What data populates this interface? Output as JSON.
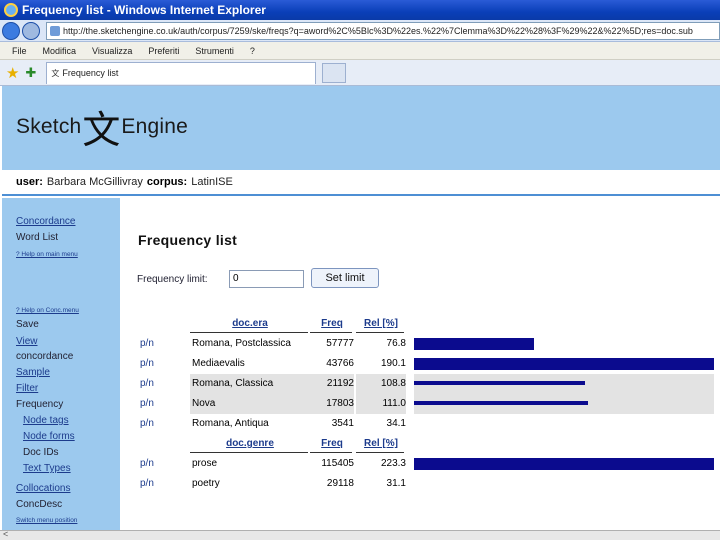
{
  "window": {
    "title": "Frequency list - Windows Internet Explorer",
    "url": "http://the.sketchengine.co.uk/auth/corpus/7259/ske/freqs?q=aword%2C%5Blc%3D%22es.%22%7Clemma%3D%22%28%3F%29%22&%22%5D;res=doc.sub",
    "menu": [
      "File",
      "Modifica",
      "Visualizza",
      "Preferiti",
      "Strumenti",
      "?"
    ],
    "tab_title": "Frequency list"
  },
  "header": {
    "logo_left": "Sketch",
    "logo_glyph": "文",
    "logo_right": "Engine",
    "user_label": "user:",
    "user_name": "Barbara McGillivray",
    "corpus_label": "corpus:",
    "corpus_name": "LatinISE"
  },
  "sidebar": {
    "concordance": "Concordance",
    "word_list": "Word List",
    "help_main": "? Help on main menu",
    "help_conc": "? Help on Conc.menu",
    "save": "Save",
    "view": "View",
    "concordance_plain": "concordance",
    "sample": "Sample",
    "filter": "Filter",
    "frequency": "Frequency",
    "node_tags": "Node tags",
    "node_forms": "Node forms",
    "doc_ids": "Doc IDs",
    "text_types": "Text Types",
    "collocations": "Collocations",
    "concdesc": "ConcDesc",
    "switch_menu": "Switch menu position"
  },
  "main": {
    "title": "Frequency list",
    "frequency_limit_label": "Frequency limit:",
    "frequency_limit_value": "0",
    "set_limit_button": "Set limit",
    "pn": "p/n",
    "tables": [
      {
        "headers": [
          "doc.era",
          "Freq",
          "Rel [%]"
        ],
        "rows": [
          {
            "label": "Romana, Postclassica",
            "freq": "57777",
            "rel": "76.8",
            "bar": 0.4,
            "shade": false
          },
          {
            "label": "Mediaevalis",
            "freq": "43766",
            "rel": "190.1",
            "bar": 1.0,
            "shade": false
          },
          {
            "label": "Romana, Classica",
            "freq": "21192",
            "rel": "108.8",
            "bar": 0.57,
            "shade": true
          },
          {
            "label": "Nova",
            "freq": "17803",
            "rel": "111.0",
            "bar": 0.58,
            "shade": true
          },
          {
            "label": "Romana, Antiqua",
            "freq": "3541",
            "rel": "34.1",
            "bar": 0.0,
            "shade": false
          }
        ]
      },
      {
        "headers": [
          "doc.genre",
          "Freq",
          "Rel [%]"
        ],
        "rows": [
          {
            "label": "prose",
            "freq": "115405",
            "rel": "223.3",
            "bar": 1.0,
            "shade": false
          },
          {
            "label": "poetry",
            "freq": "29118",
            "rel": "31.1",
            "bar": 0.0,
            "shade": false
          }
        ]
      }
    ]
  },
  "colors": {
    "chrome_blue": "#0a3fb8",
    "page_blue": "#9cc9ee",
    "bar_navy": "#0b0b8e",
    "shade_gray": "#e3e3e3"
  }
}
